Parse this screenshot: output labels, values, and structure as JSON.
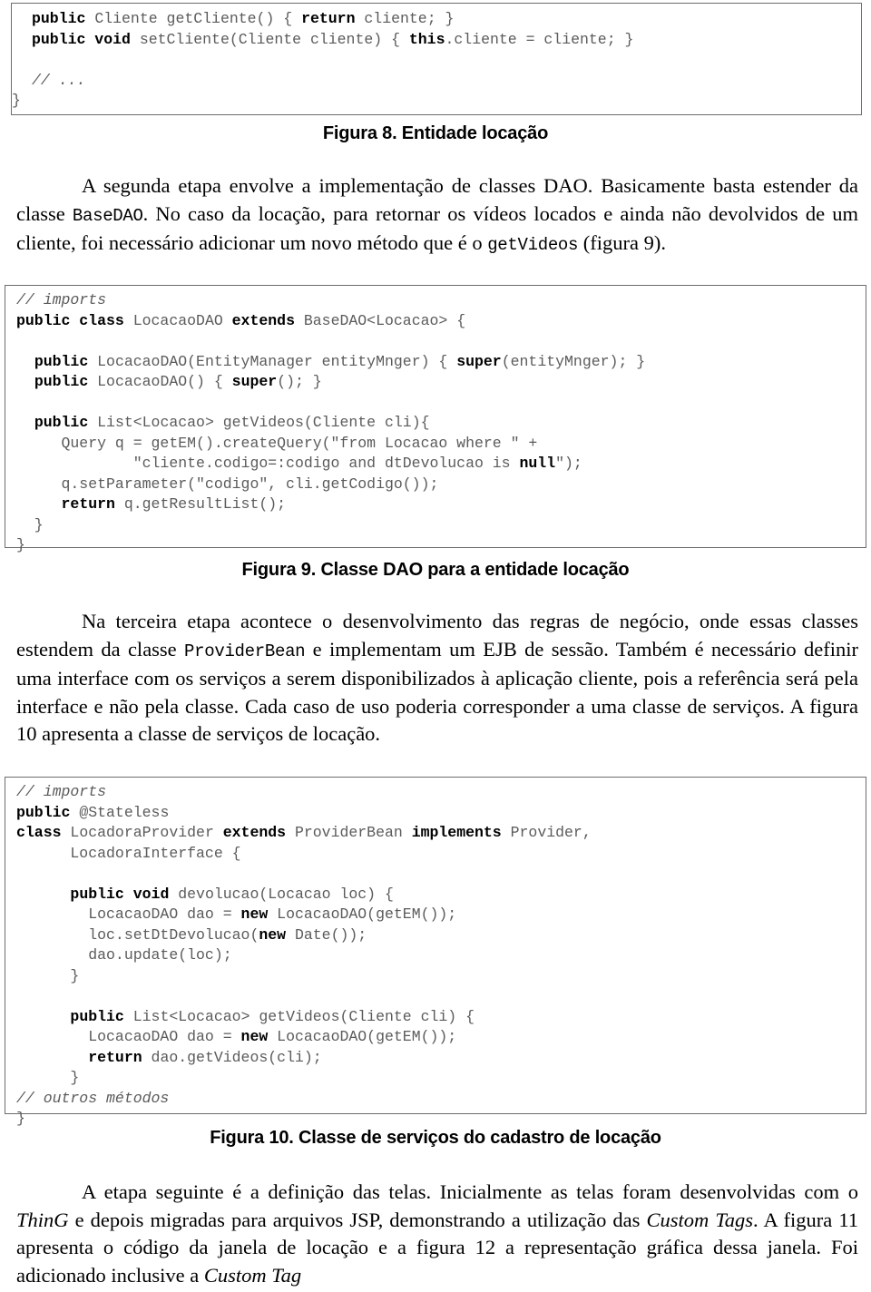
{
  "document": {
    "language": "pt-BR",
    "page_type": "academic-paper-body"
  },
  "code_block_1": {
    "name": "entidade-locacao-snippet",
    "lines": [
      "    public Cliente getCliente() { return cliente; }",
      "    public void setCliente(Cliente cliente) { this.cliente = cliente; }",
      "",
      "    // ...",
      "}"
    ],
    "text": "    public Cliente getCliente() { return cliente; }\n    public void setCliente(Cliente cliente) { this.cliente = cliente; }\n\n    // ...\n}"
  },
  "fig8_caption": "Figura 8. Entidade locação",
  "paragraph_1": {
    "before_code": "A segunda etapa envolve a implementação de classes DAO. Basicamente basta estender da classe ",
    "code_1": "BaseDAO",
    "middle": ". No caso da locação, para retornar os vídeos locados e ainda não devolvidos de um cliente, foi necessário adicionar um novo método que é o ",
    "code_2": "getVideos",
    "after": " (figura 9)."
  },
  "code_block_2": {
    "name": "locacaodao-class",
    "text": "// imports\npublic class LocacaoDAO extends BaseDAO<Locacao> {\n\n  public LocacaoDAO(EntityManager entityMnger) { super(entityMnger); }\n  public LocacaoDAO() { super(); }\n\n  public List<Locacao> getVideos(Cliente cli){\n     Query q = getEM().createQuery(\"from Locacao where \" +\n             \"cliente.codigo=:codigo and dtDevolucao is null\");\n     q.setParameter(\"codigo\", cli.getCodigo());\n     return q.getResultList();\n  }\n}"
  },
  "fig9_caption": "Figura 9. Classe DAO para a entidade locação",
  "paragraph_2": {
    "before_code": "Na terceira etapa acontece o desenvolvimento das regras de negócio, onde essas classes estendem da classe ",
    "code_1": "ProviderBean",
    "after": " e implementam um EJB de sessão. Também é necessário definir uma interface com os serviços a serem disponibilizados à aplicação cliente, pois a referência será pela interface e não pela classe. Cada caso de uso poderia corresponder a uma classe de serviços. A figura 10 apresenta a classe de serviços de locação."
  },
  "code_block_3": {
    "name": "locadoraprovider-class",
    "text": "// imports\npublic @Stateless\nclass LocadoraProvider extends ProviderBean implements Provider,\n      LocadoraInterface {\n\n      public void devolucao(Locacao loc) {\n        LocacaoDAO dao = new LocacaoDAO(getEM());\n        loc.setDtDevolucao(new Date());\n        dao.update(loc);\n      }\n\n      public List<Locacao> getVideos(Cliente cli) {\n        LocacaoDAO dao = new LocacaoDAO(getEM());\n        return dao.getVideos(cli);\n      }\n// outros métodos\n}"
  },
  "fig10_caption": "Figura 10. Classe de serviços do cadastro de locação",
  "paragraph_3": {
    "segment_1": "A etapa seguinte é a definição das telas. Inicialmente as telas foram desenvolvidas com o ",
    "italic_1": "ThinG",
    "segment_2": " e depois migradas para arquivos JSP, demonstrando a utilização das ",
    "italic_2": "Custom Tags",
    "segment_3": ". A figura 11 apresenta o código da janela de locação e a figura 12 a representação gráfica dessa janela. Foi adicionado inclusive a ",
    "italic_3": "Custom Tag"
  },
  "colors": {
    "text": "#000000",
    "code_normal": "#5b5b5b",
    "code_keyword": "#000000",
    "box_border": "#6d6d6d",
    "background": "#ffffff"
  }
}
